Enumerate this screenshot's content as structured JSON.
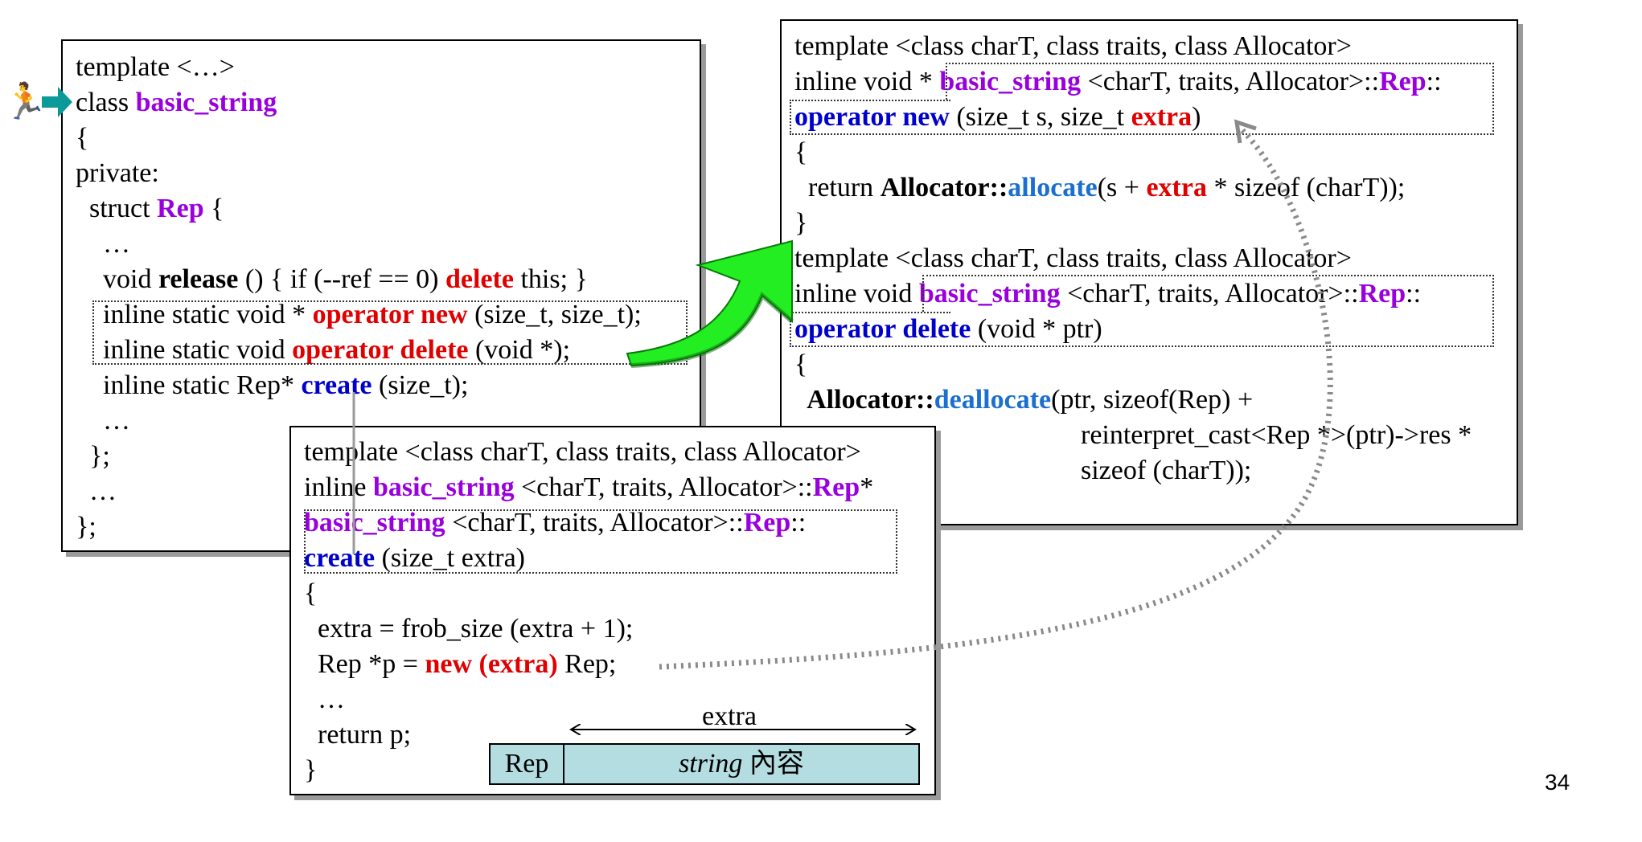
{
  "left_box": {
    "lines": [
      "template <…>",
      "class ",
      "basic_string",
      "{",
      "private:",
      "  struct ",
      "Rep",
      " {",
      "    …",
      "    void ",
      "release",
      " () { if (--ref == 0) ",
      "delete",
      " this; }",
      "    inline static void * ",
      "operator new",
      " (size_t, size_t);",
      "    inline static void ",
      "operator delete",
      " (void *);",
      "    inline static Rep* ",
      "create",
      " (size_t);",
      "    …",
      "  };",
      "  …",
      "};"
    ]
  },
  "right_box": {
    "t1": "template <class charT, class traits, class Allocator>",
    "l2a": "inline void * ",
    "l2b": "basic_string",
    "l2c": " <charT, traits, Allocator>::",
    "l2d": "Rep",
    "l2e": "::",
    "l3a": "operator new",
    "l3b": " (size_t s, size_t ",
    "l3c": "extra",
    "l3d": ")",
    "l4": "{",
    "l5a": "  return ",
    "l5b": "Allocator::",
    "l5c": "allocate",
    "l5d": "(s + ",
    "l5e": "extra",
    "l5f": " * sizeof (charT));",
    "l6": "}",
    "t2": "template <class charT, class traits, class Allocator>",
    "l8a": "inline void ",
    "l8b": "basic_string",
    "l8c": " <charT, traits, Allocator>::",
    "l8d": "Rep",
    "l8e": "::",
    "l9a": "operator delete",
    "l9b": " (void * ptr)",
    "l10": "{",
    "l11a": "  Allocator::",
    "l11b": "deallocate",
    "l11c": "(ptr, sizeof(Rep) +",
    "l12": "reinterpret_cast<Rep *>(ptr)->res *",
    "l13": "sizeof (charT));"
  },
  "bottom_box": {
    "t1": "template <class charT, class traits, class Allocator>",
    "l2a": "inline ",
    "l2b": "basic_string",
    "l2c": " <charT, traits, Allocator>::",
    "l2d": "Rep",
    "l2e": "*",
    "l3a": "basic_string",
    "l3b": " <charT, traits, Allocator>::",
    "l3c": "Rep",
    "l3d": "::",
    "l4a": "create",
    "l4b": " (size_t extra)",
    "l5": "{",
    "l6": "  extra = frob_size (extra + 1);",
    "l7a": "  Rep *p = ",
    "l7b": "new (extra)",
    "l7c": " Rep;",
    "l8": "  …",
    "l9": "  return p;",
    "l10": "}"
  },
  "memory": {
    "rep_label": "Rep",
    "content_italic": "string",
    "content_rest": " 內容",
    "extra_label": "extra"
  },
  "page_number": "34",
  "colors": {
    "purple": "#9900dd",
    "red": "#e00000",
    "blue": "#0000cc",
    "light_blue": "#1a6fd0",
    "big_arrow": "#22ee22",
    "teal_arrow": "#0a9a9a",
    "memory_fill": "#b4dde2",
    "dotted_arrow": "#888888"
  }
}
